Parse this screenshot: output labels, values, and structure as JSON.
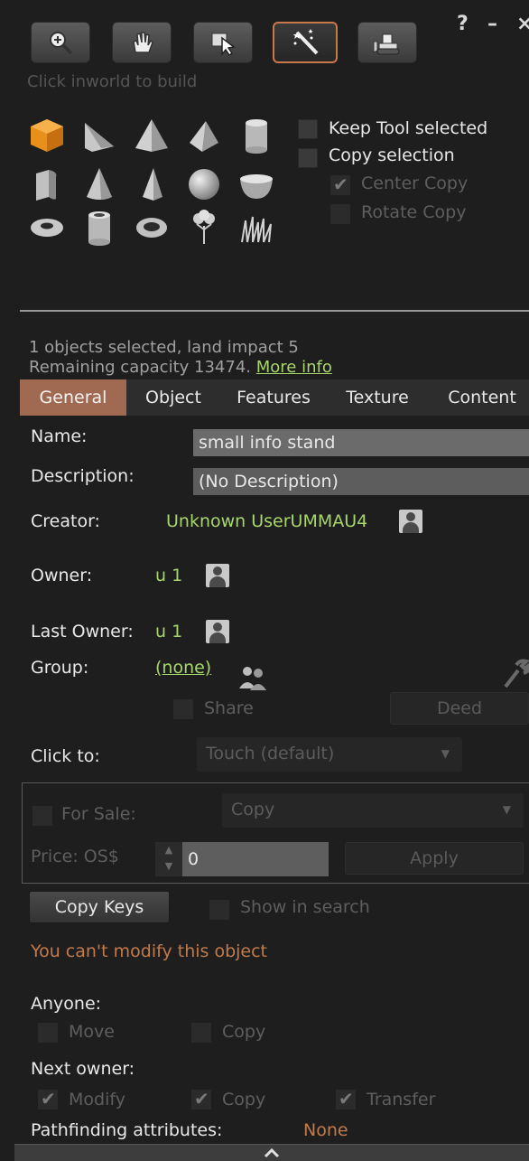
{
  "window": {
    "help_label": "?",
    "minimize_label": "–",
    "close_label": "×"
  },
  "toolbar": {
    "tools": [
      {
        "name": "focus-tool",
        "icon": "magnifier-icon",
        "active": false
      },
      {
        "name": "move-tool",
        "icon": "hand-icon",
        "active": false
      },
      {
        "name": "edit-tool",
        "icon": "pointer-icon",
        "active": false
      },
      {
        "name": "create-tool",
        "icon": "magic-wand-icon",
        "active": true
      },
      {
        "name": "land-tool",
        "icon": "bulldozer-icon",
        "active": false
      }
    ],
    "hint": "Click inworld to build"
  },
  "shapes": [
    "cube-icon",
    "prism-icon",
    "pyramid-icon",
    "tetrahedron-icon",
    "cylinder-icon",
    "half-cylinder-icon",
    "cone-icon",
    "half-cone-icon",
    "sphere-icon",
    "hemisphere-icon",
    "torus-icon",
    "tube-icon",
    "ring-icon",
    "tree-icon",
    "grass-icon"
  ],
  "options": {
    "keep_tool": "Keep Tool selected",
    "copy_selection": "Copy selection",
    "center_copy": "Center Copy",
    "rotate_copy": "Rotate Copy"
  },
  "selection_info": {
    "line1": "1 objects selected, land impact 5",
    "line2": "Remaining capacity 13474.",
    "more_info": "More info"
  },
  "tabs": [
    "General",
    "Object",
    "Features",
    "Texture",
    "Content"
  ],
  "general": {
    "name_label": "Name:",
    "name_value": "small info stand",
    "description_label": "Description:",
    "description_value": "(No Description)",
    "creator_label": "Creator:",
    "creator_value": "Unknown UserUMMAU4",
    "owner_label": "Owner:",
    "owner_value": "u 1",
    "last_owner_label": "Last Owner:",
    "last_owner_value": "u 1",
    "group_label": "Group:",
    "group_value": "(none)",
    "share_label": "Share",
    "deed_label": "Deed",
    "click_to_label": "Click to:",
    "click_to_value": "Touch  (default)",
    "for_sale_label": "For Sale:",
    "sale_type_value": "Copy",
    "price_label": "Price: OS$",
    "price_value": "0",
    "apply_label": "Apply",
    "copy_keys_label": "Copy Keys",
    "show_in_search_label": "Show in search",
    "warning": "You can't modify this object",
    "anyone_label": "Anyone:",
    "anyone_move": "Move",
    "anyone_copy": "Copy",
    "next_owner_label": "Next owner:",
    "next_modify": "Modify",
    "next_copy": "Copy",
    "next_transfer": "Transfer",
    "pathfinding_label": "Pathfinding attributes:",
    "pathfinding_value": "None"
  },
  "colors": {
    "accent_tab": "#a06a52",
    "link_green": "#a7d66c",
    "warning_orange": "#c27a4a",
    "active_tool_border": "#c8784a"
  }
}
